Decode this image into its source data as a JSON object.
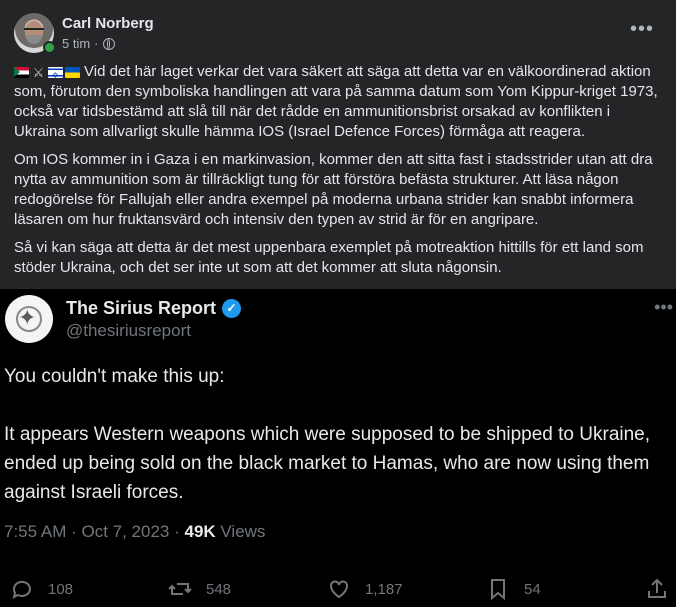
{
  "post": {
    "author": "Carl Norberg",
    "time": "5 tim",
    "separator": "·",
    "more": "•••",
    "paragraph1": "Vid det här laget verkar det vara säkert att säga att detta var en välkoordinerad aktion som, förutom den symboliska handlingen att vara på samma datum som Yom Kippur-kriget 1973, också var tidsbestämd att slå till när det rådde en ammunitionsbrist orsakad av konflikten i Ukraina som allvarligt skulle hämma IOS (Israel Defence Forces) förmåga att reagera.",
    "paragraph2": "Om IOS kommer in i Gaza i en markinvasion, kommer den att sitta fast i stadsstrider utan att dra nytta av ammunition som är tillräckligt tung för att förstöra befästa strukturer. Att läsa någon redogörelse för Fallujah eller andra exempel på moderna urbana strider kan snabbt informera läsaren om hur fruktansvärd och intensiv den typen av strid är för en angripare.",
    "paragraph3": "Så vi kan säga att detta är det mest uppenbara exemplet på motreaktion hittills för ett land som stöder Ukraina, och det ser inte ut som att det kommer att sluta någonsin.",
    "flag_icons": [
      "palestine-flag-icon",
      "crossed-swords-icon",
      "israel-flag-icon",
      "ukraine-flag-icon"
    ]
  },
  "tweet": {
    "name": "The Sirius Report",
    "handle": "@thesiriusreport",
    "more": "•••",
    "line1": "You couldn't make this up:",
    "line2": "It appears Western weapons which were supposed to be shipped to Ukraine, ended up being sold on the black market to Hamas, who are now using them against Israeli forces.",
    "time": "7:55 AM · Oct 7, 2023 · ",
    "views_count": "49K",
    "views_label": " Views",
    "replies": "108",
    "retweets": "548",
    "likes": "1,187",
    "bookmarks": "54"
  },
  "colors": {
    "background": "#242526",
    "embed_background": "#000000",
    "verified": "#1d9bf0",
    "online": "#31a24c"
  }
}
